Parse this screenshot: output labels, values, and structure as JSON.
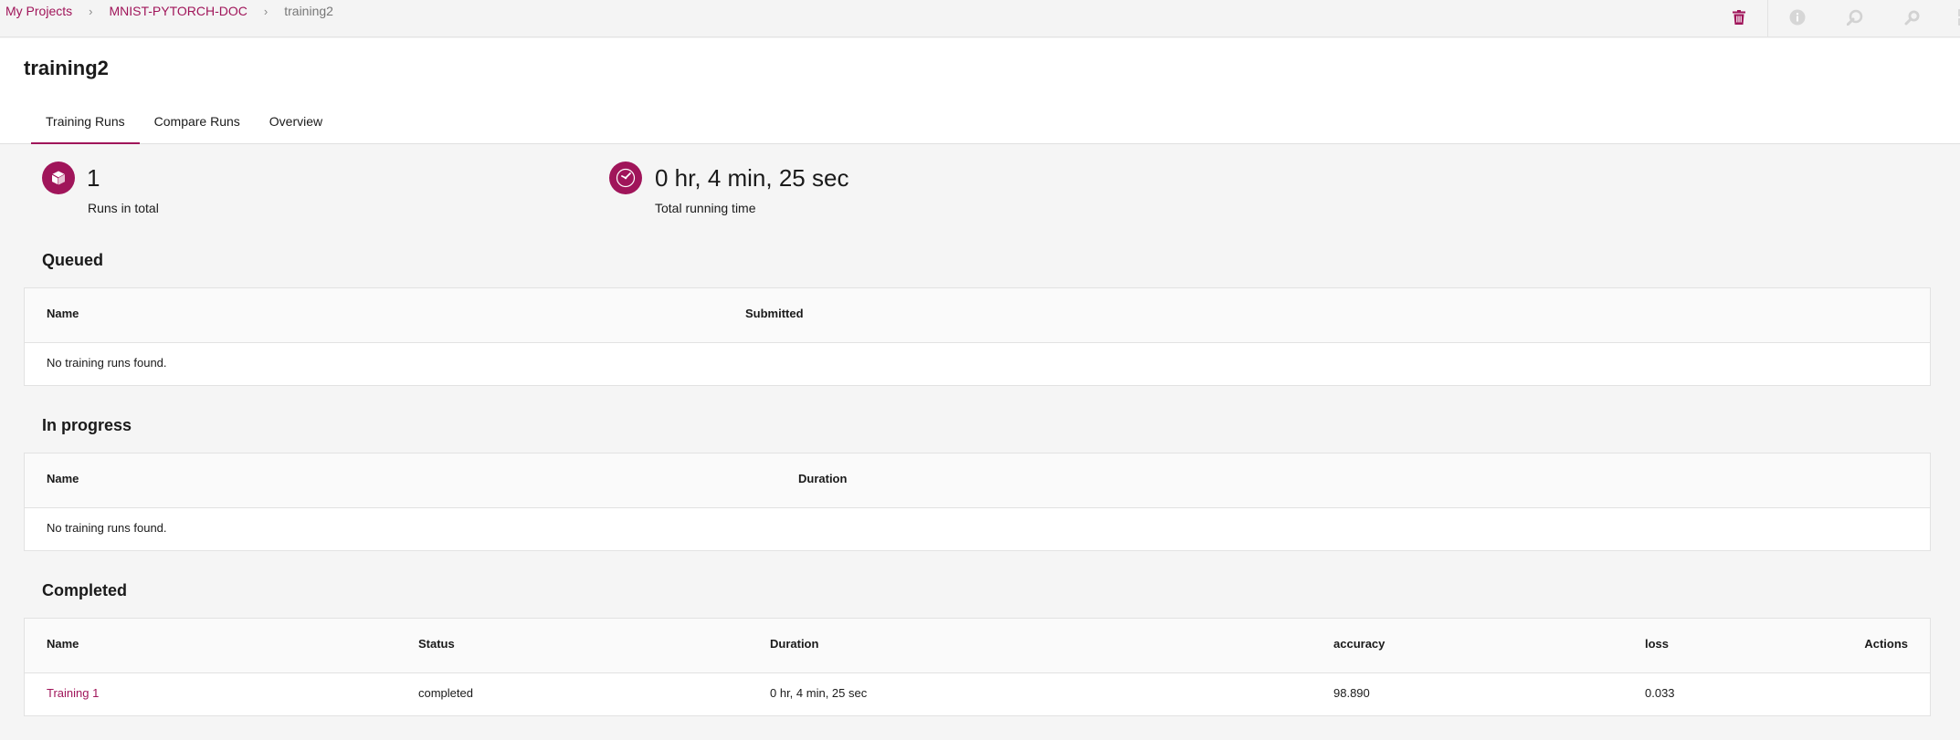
{
  "breadcrumb": {
    "items": [
      "My Projects",
      "MNIST-PYTORCH-DOC"
    ],
    "current": "training2"
  },
  "toolbar": {
    "icons": [
      "trash-icon",
      "info-icon",
      "rerun-icon",
      "search-icon",
      "grid-icon"
    ],
    "accent": "#a0155a"
  },
  "page": {
    "title": "training2",
    "tabs": [
      "Training Runs",
      "Compare Runs",
      "Overview"
    ],
    "active_tab": "Training Runs"
  },
  "stats": {
    "runs_total": {
      "value": "1",
      "label": "Runs in total",
      "icon": "cube-icon"
    },
    "running_time": {
      "value": "0 hr, 4 min, 25 sec",
      "label": "Total running time",
      "icon": "clock-icon"
    }
  },
  "queued": {
    "title": "Queued",
    "columns": [
      "Name",
      "Submitted"
    ],
    "empty": "No training runs found."
  },
  "in_progress": {
    "title": "In progress",
    "columns": [
      "Name",
      "Duration"
    ],
    "empty": "No training runs found."
  },
  "completed": {
    "title": "Completed",
    "columns": [
      "Name",
      "Status",
      "Duration",
      "accuracy",
      "loss",
      "Actions"
    ],
    "rows": [
      {
        "name": "Training 1",
        "status": "completed",
        "duration": "0 hr, 4 min, 25 sec",
        "accuracy": "98.890",
        "loss": "0.033",
        "actions": ""
      }
    ]
  }
}
